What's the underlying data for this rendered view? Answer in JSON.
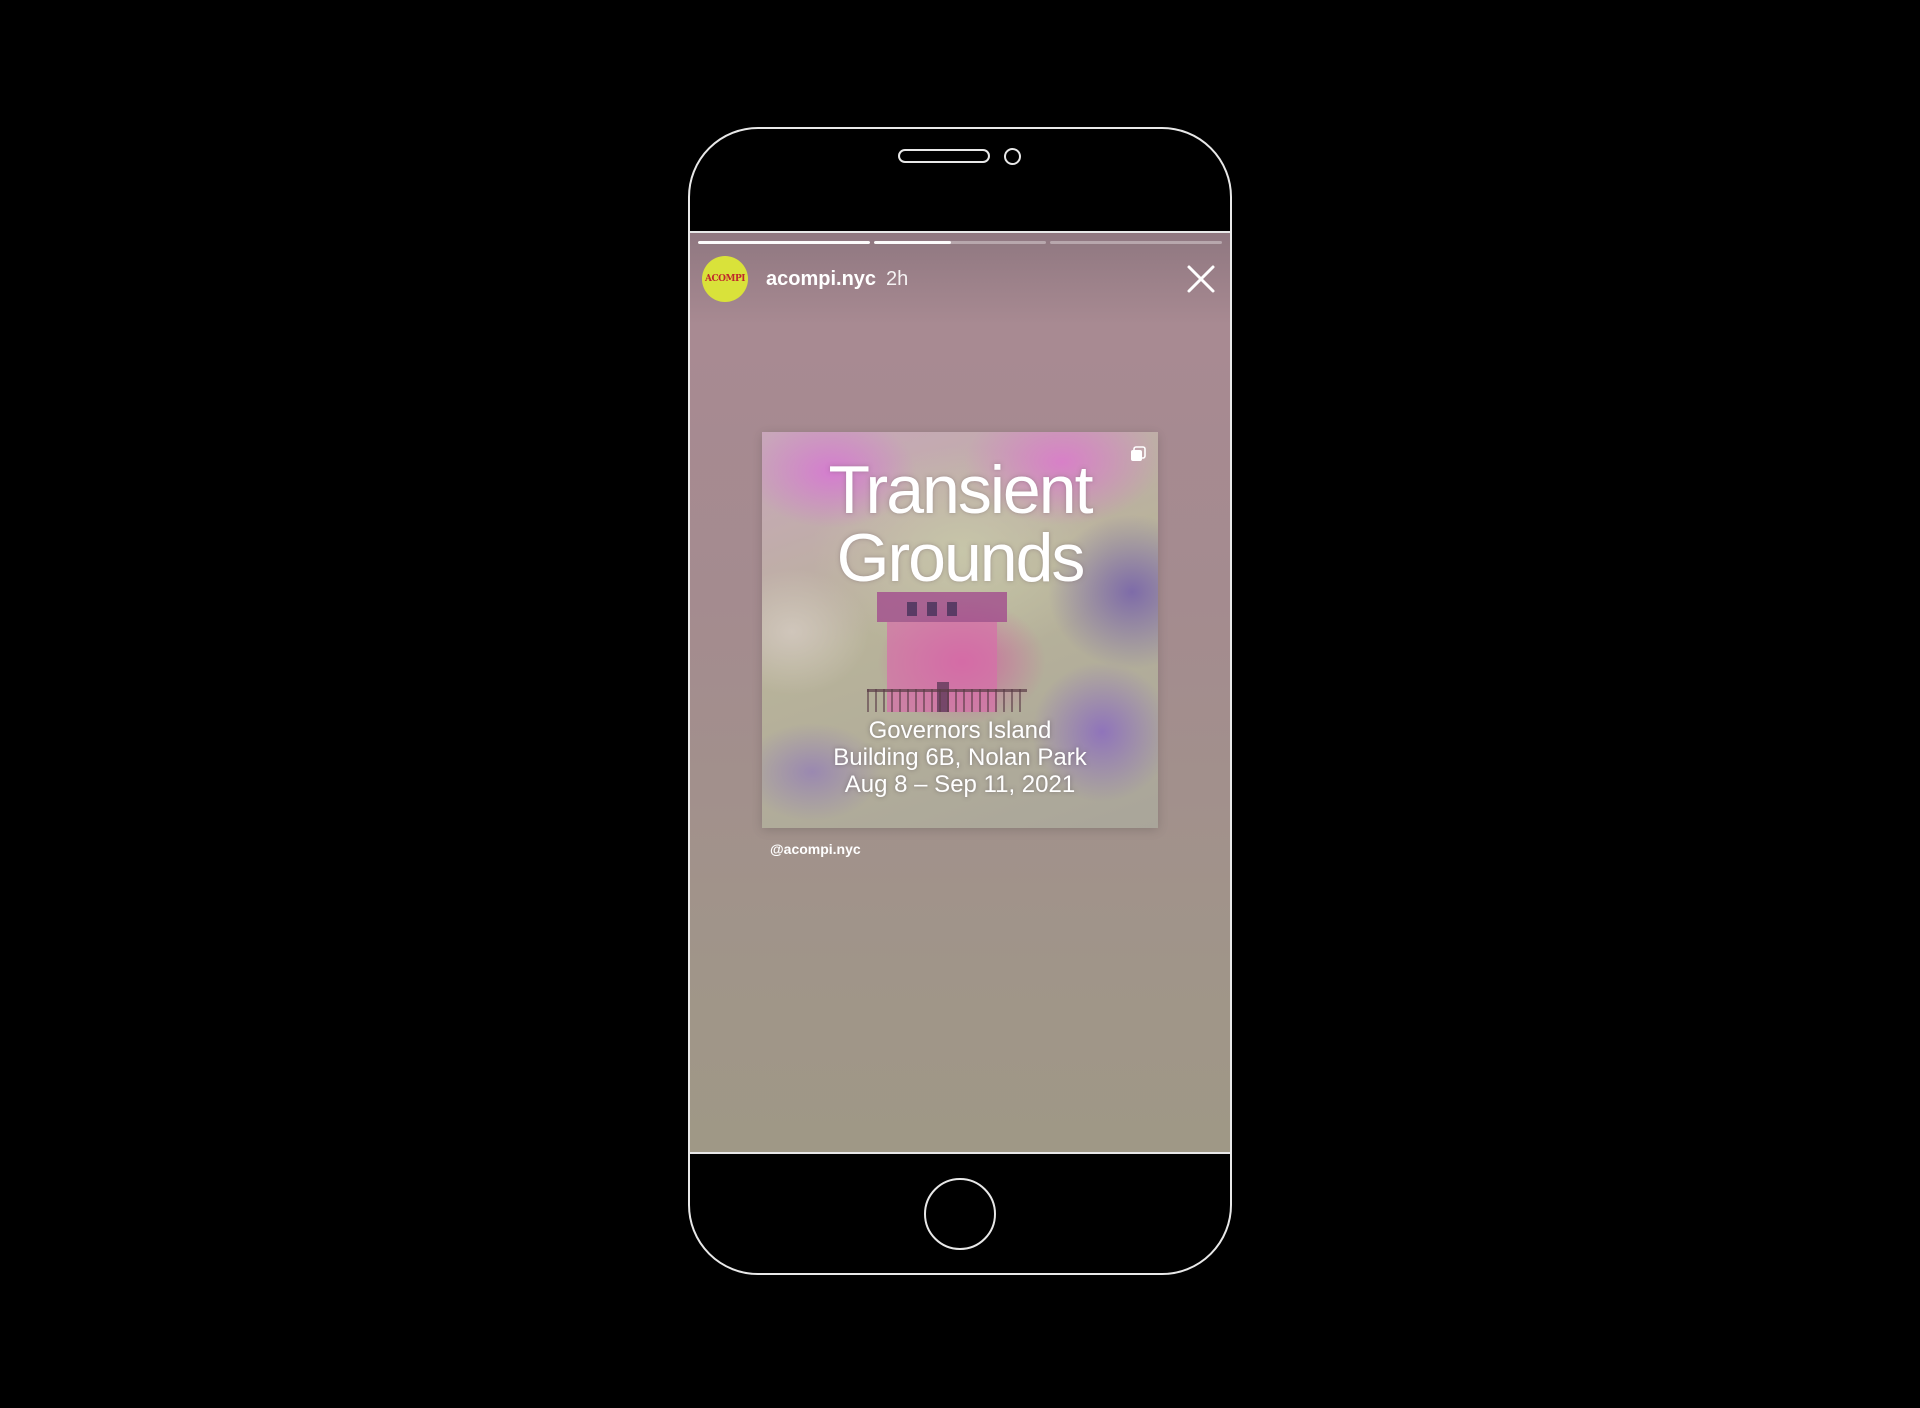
{
  "story": {
    "progress": [
      1.0,
      0.45,
      0.0
    ],
    "username": "acompi.nyc",
    "time": "2h",
    "avatar_text": "ACOMPI",
    "avatar_color": "#d9e23a",
    "close_icon": "close-icon"
  },
  "post": {
    "title_line1": "Transient",
    "title_line2": "Grounds",
    "location": "Governors Island",
    "address": "Building 6B, Nolan Park",
    "dates": "Aug 8 – Sep 11, 2021",
    "corner_icon": "multiple-images-icon",
    "caption": "@acompi.nyc"
  }
}
